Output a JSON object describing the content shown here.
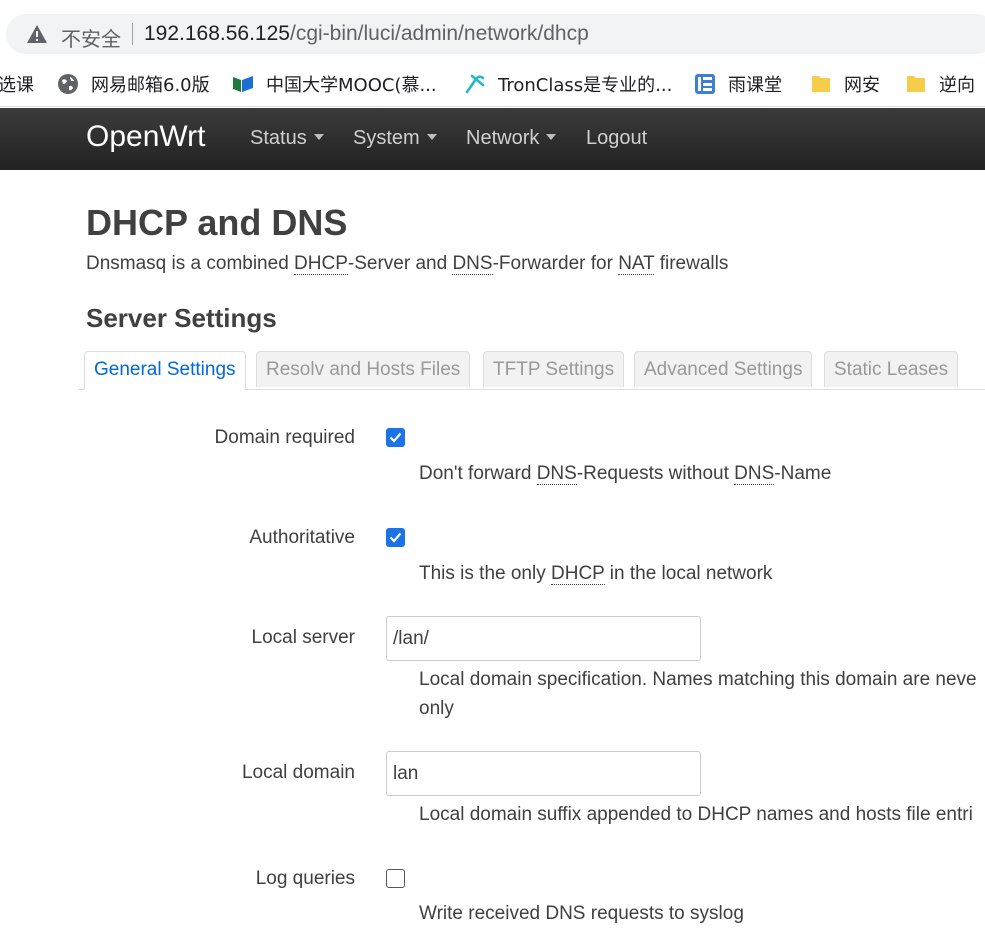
{
  "browser": {
    "security_label": "不安全",
    "url_host": "192.168.56.125",
    "url_path": "/cgi-bin/luci/admin/network/dhcp",
    "bookmarks": [
      {
        "label": "选课",
        "icon": "none"
      },
      {
        "label": "网易邮箱6.0版",
        "icon": "globe-icon"
      },
      {
        "label": "中国大学MOOC(慕...",
        "icon": "mooc-icon"
      },
      {
        "label": "TronClass是专业的...",
        "icon": "tronclass-icon"
      },
      {
        "label": "雨课堂",
        "icon": "yuketang-icon"
      },
      {
        "label": "网安",
        "icon": "folder-icon"
      },
      {
        "label": "逆向",
        "icon": "folder-icon"
      }
    ]
  },
  "navbar": {
    "brand": "OpenWrt",
    "menu": [
      "Status",
      "System",
      "Network",
      "Logout"
    ]
  },
  "page": {
    "title": "DHCP and DNS",
    "description": {
      "part1": "Dnsmasq is a combined ",
      "abbr1": "DHCP",
      "part2": "-Server and ",
      "abbr2": "DNS",
      "part3": "-Forwarder for ",
      "abbr3": "NAT",
      "part4": " firewalls"
    },
    "section_title": "Server Settings",
    "tabs": [
      "General Settings",
      "Resolv and Hosts Files",
      "TFTP Settings",
      "Advanced Settings",
      "Static Leases"
    ],
    "active_tab": "General Settings"
  },
  "fields": {
    "domain_required": {
      "label": "Domain required",
      "checked": true,
      "help_part1": "Don't forward ",
      "help_abbr1": "DNS",
      "help_part2": "-Requests without ",
      "help_abbr2": "DNS",
      "help_part3": "-Name"
    },
    "authoritative": {
      "label": "Authoritative",
      "checked": true,
      "help_part1": "This is the only ",
      "help_abbr1": "DHCP",
      "help_part2": " in the local network"
    },
    "local_server": {
      "label": "Local server",
      "value": "/lan/",
      "help_line1": "Local domain specification. Names matching this domain are neve",
      "help_line2": "only"
    },
    "local_domain": {
      "label": "Local domain",
      "value": "lan",
      "help": "Local domain suffix appended to DHCP names and hosts file entri"
    },
    "log_queries": {
      "label": "Log queries",
      "checked": false,
      "help": "Write received DNS requests to syslog"
    }
  },
  "colors": {
    "navbar": "#2b2b2b",
    "active_tab": "#0069d6",
    "checkbox": "#1a73e8"
  }
}
